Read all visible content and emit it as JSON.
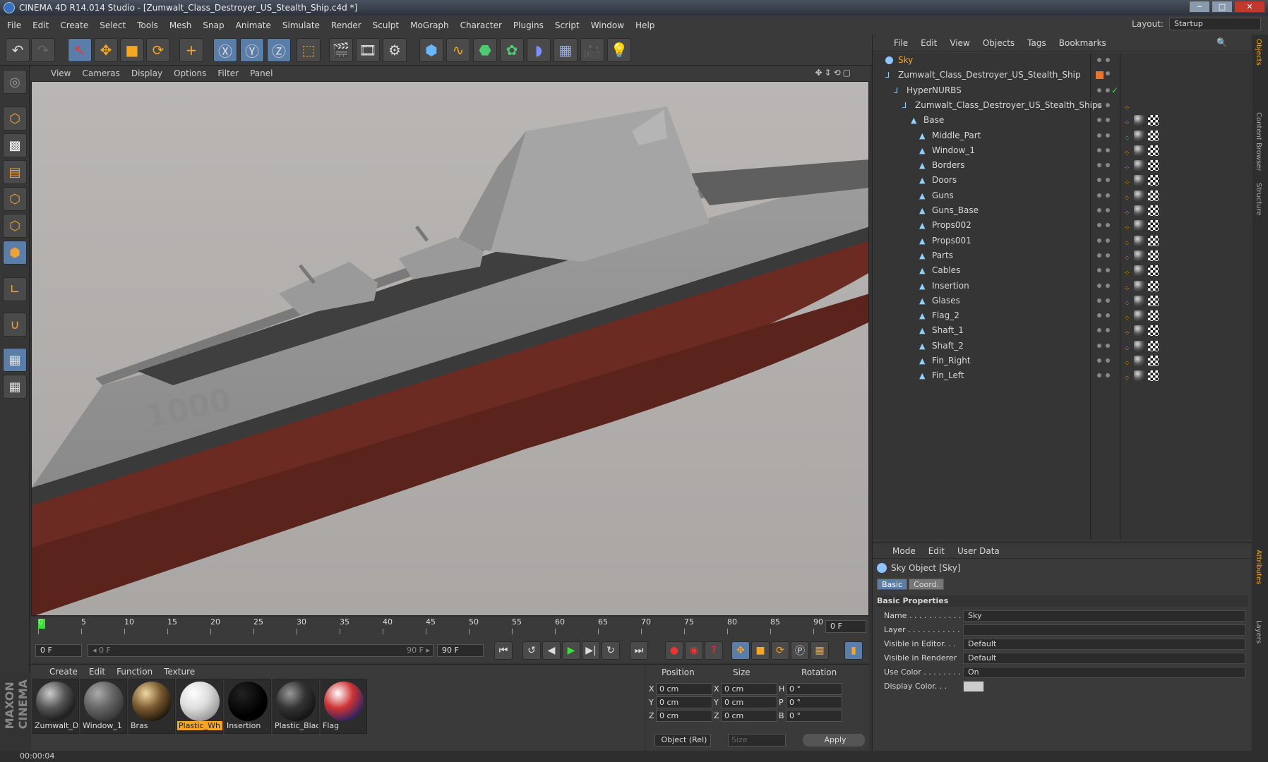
{
  "window": {
    "title": "CINEMA 4D R14.014 Studio - [Zumwalt_Class_Destroyer_US_Stealth_Ship.c4d *]",
    "min": "─",
    "max": "□",
    "close": "✕"
  },
  "menu": [
    "File",
    "Edit",
    "Create",
    "Select",
    "Tools",
    "Mesh",
    "Snap",
    "Animate",
    "Simulate",
    "Render",
    "Sculpt",
    "MoGraph",
    "Character",
    "Plugins",
    "Script",
    "Window",
    "Help"
  ],
  "layout": {
    "label": "Layout:",
    "value": "Startup"
  },
  "viewport": {
    "menu": [
      "View",
      "Cameras",
      "Display",
      "Options",
      "Filter",
      "Panel"
    ],
    "icons": "✥⇕⟲▢",
    "hull_number": "1000"
  },
  "timeline": {
    "ticks": [
      "0",
      "5",
      "10",
      "15",
      "20",
      "25",
      "30",
      "35",
      "40",
      "45",
      "50",
      "55",
      "60",
      "65",
      "70",
      "75",
      "80",
      "85",
      "90"
    ],
    "current_frame": "0 F",
    "start": "0 F",
    "range_start": "◂ 0 F",
    "range_end": "90 F ▸",
    "end": "90 F"
  },
  "materials": {
    "menu": [
      "Create",
      "Edit",
      "Function",
      "Texture"
    ],
    "items": [
      {
        "name": "Zumwalt_D"
      },
      {
        "name": "Window_1"
      },
      {
        "name": "Bras"
      },
      {
        "name": "Plastic_Wh"
      },
      {
        "name": "Insertion"
      },
      {
        "name": "Plastic_Blac"
      },
      {
        "name": "Flag"
      }
    ]
  },
  "coords": {
    "headers": [
      "Position",
      "Size",
      "Rotation"
    ],
    "rows": [
      {
        "a": "X",
        "pos": "0 cm",
        "b": "X",
        "size": "0 cm",
        "c": "H",
        "rot": "0 °"
      },
      {
        "a": "Y",
        "pos": "0 cm",
        "b": "Y",
        "size": "0 cm",
        "c": "P",
        "rot": "0 °"
      },
      {
        "a": "Z",
        "pos": "0 cm",
        "b": "Z",
        "size": "0 cm",
        "c": "B",
        "rot": "0 °"
      }
    ],
    "mode": "Object (Rel)",
    "size_mode": "Size",
    "apply": "Apply"
  },
  "objects": {
    "menu": [
      "File",
      "Edit",
      "View",
      "Objects",
      "Tags",
      "Bookmarks"
    ],
    "items": [
      {
        "name": "Sky"
      },
      {
        "name": "Zumwalt_Class_Destroyer_US_Stealth_Ship"
      },
      {
        "name": "HyperNURBS"
      },
      {
        "name": "Zumwalt_Class_Destroyer_US_Stealth_Ships"
      },
      {
        "name": "Base"
      },
      {
        "name": "Middle_Part"
      },
      {
        "name": "Window_1"
      },
      {
        "name": "Borders"
      },
      {
        "name": "Doors"
      },
      {
        "name": "Guns"
      },
      {
        "name": "Guns_Base"
      },
      {
        "name": "Props002"
      },
      {
        "name": "Props001"
      },
      {
        "name": "Parts"
      },
      {
        "name": "Cables"
      },
      {
        "name": "Insertion"
      },
      {
        "name": "Glases"
      },
      {
        "name": "Flag_2"
      },
      {
        "name": "Shaft_1"
      },
      {
        "name": "Shaft_2"
      },
      {
        "name": "Fin_Right"
      },
      {
        "name": "Fin_Left"
      }
    ],
    "check": "✓"
  },
  "attributes": {
    "menu": [
      "Mode",
      "Edit",
      "User Data"
    ],
    "object_title": "Sky Object [Sky]",
    "tabs": [
      "Basic",
      "Coord."
    ],
    "section": "Basic Properties",
    "rows": [
      {
        "label": "Name . . . . . . . . . . .",
        "value": "Sky"
      },
      {
        "label": "Layer . . . . . . . . . . .",
        "value": ""
      },
      {
        "label": "Visible in Editor. . .",
        "value": "Default"
      },
      {
        "label": "Visible in Renderer",
        "value": "Default"
      },
      {
        "label": "Use Color . . . . . . . .",
        "value": "On"
      },
      {
        "label": "Display Color. . .",
        "value": ""
      }
    ]
  },
  "right_tabs": [
    "Objects",
    "Content Browser",
    "Structure",
    "Attributes",
    "Layers"
  ],
  "status": {
    "time": "00:00:04"
  },
  "colors": {
    "accent": "#f5a623",
    "active_blue": "#5b7ea8"
  }
}
